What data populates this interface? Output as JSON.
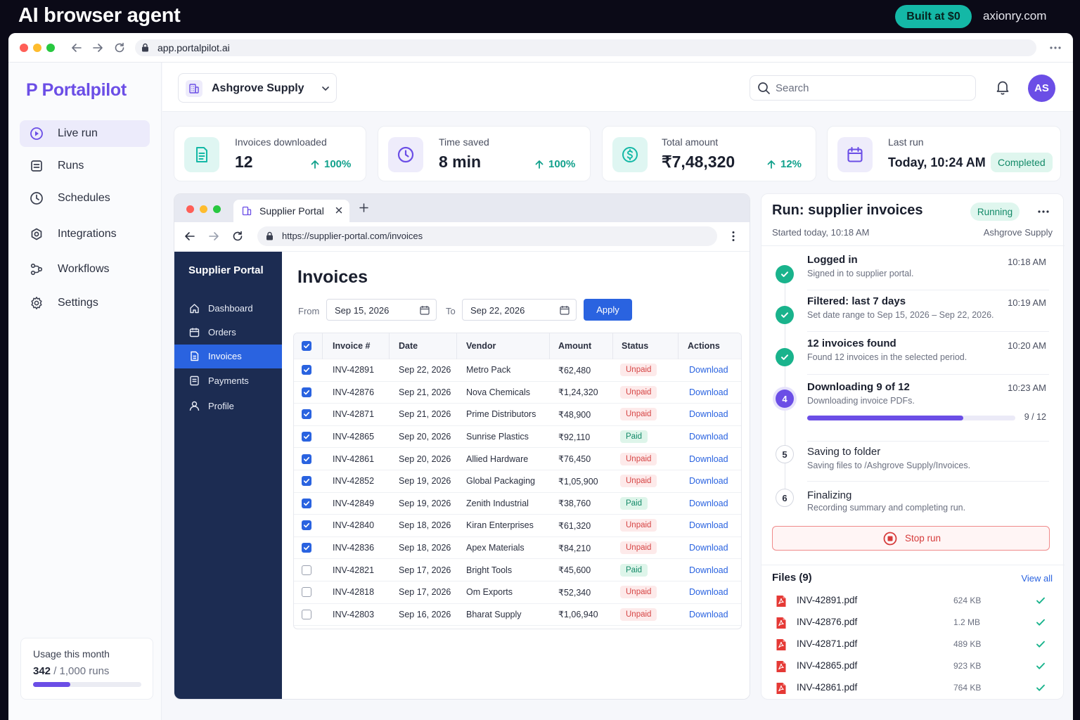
{
  "banner": {
    "title": "AI browser agent",
    "pill": "Built at $0",
    "site": "axionry.com"
  },
  "browser": {
    "url": "app.portalpilot.ai"
  },
  "app": {
    "logo": "P Portalpilot",
    "nav": [
      {
        "label": "Live run",
        "icon": "play-circle-icon",
        "active": true
      },
      {
        "label": "Runs",
        "icon": "list-icon"
      },
      {
        "label": "Schedules",
        "icon": "clock-icon"
      },
      {
        "label": "Integrations",
        "icon": "puzzle-icon"
      },
      {
        "label": "Workflows",
        "icon": "workflow-icon"
      },
      {
        "label": "Settings",
        "icon": "gear-icon"
      }
    ],
    "usage": {
      "title": "Usage this month",
      "used": "342",
      "total": "/ 1,000 runs",
      "fraction": 0.342
    }
  },
  "header": {
    "org": "Ashgrove Supply",
    "search_placeholder": "Search",
    "avatar": "AS"
  },
  "stats": [
    {
      "label": "Invoices downloaded",
      "value": "12",
      "trend": "100%",
      "color": "#14b8a6"
    },
    {
      "label": "Time saved",
      "value": "8 min",
      "trend": "100%",
      "color": "#6b4ee6"
    },
    {
      "label": "Total amount",
      "value": "₹7,48,320",
      "trend": "12%",
      "color": "#14b8a6"
    },
    {
      "label": "Last run",
      "value": "Today, 10:24 AM",
      "badge": "Completed",
      "color": "#6b4ee6"
    }
  ],
  "portal": {
    "tab_title": "Supplier Portal",
    "url": "https://supplier-portal.com/invoices",
    "brand": "Supplier Portal",
    "nav": [
      {
        "label": "Dashboard",
        "icon": "home-icon"
      },
      {
        "label": "Orders",
        "icon": "orders-icon"
      },
      {
        "label": "Invoices",
        "icon": "invoice-icon",
        "active": true
      },
      {
        "label": "Payments",
        "icon": "payments-icon"
      },
      {
        "label": "Profile",
        "icon": "user-icon"
      }
    ],
    "page_title": "Invoices",
    "filter": {
      "from_label": "From",
      "from": "Sep 15, 2026",
      "to_label": "To",
      "to": "Sep 22, 2026",
      "apply": "Apply"
    },
    "columns": [
      "Invoice #",
      "Date",
      "Vendor",
      "Amount",
      "Status",
      "Actions"
    ],
    "rows": [
      {
        "checked": true,
        "id": "INV-42891",
        "date": "Sep 22, 2026",
        "vendor": "Metro Pack",
        "amount": "₹62,480",
        "status": "Unpaid",
        "action": "Download"
      },
      {
        "checked": true,
        "id": "INV-42876",
        "date": "Sep 21, 2026",
        "vendor": "Nova Chemicals",
        "amount": "₹1,24,320",
        "status": "Unpaid",
        "action": "Download"
      },
      {
        "checked": true,
        "id": "INV-42871",
        "date": "Sep 21, 2026",
        "vendor": "Prime Distributors",
        "amount": "₹48,900",
        "status": "Unpaid",
        "action": "Download"
      },
      {
        "checked": true,
        "id": "INV-42865",
        "date": "Sep 20, 2026",
        "vendor": "Sunrise Plastics",
        "amount": "₹92,110",
        "status": "Paid",
        "action": "Download"
      },
      {
        "checked": true,
        "id": "INV-42861",
        "date": "Sep 20, 2026",
        "vendor": "Allied Hardware",
        "amount": "₹76,450",
        "status": "Unpaid",
        "action": "Download"
      },
      {
        "checked": true,
        "id": "INV-42852",
        "date": "Sep 19, 2026",
        "vendor": "Global Packaging",
        "amount": "₹1,05,900",
        "status": "Unpaid",
        "action": "Download"
      },
      {
        "checked": true,
        "id": "INV-42849",
        "date": "Sep 19, 2026",
        "vendor": "Zenith Industrial",
        "amount": "₹38,760",
        "status": "Paid",
        "action": "Download"
      },
      {
        "checked": true,
        "id": "INV-42840",
        "date": "Sep 18, 2026",
        "vendor": "Kiran Enterprises",
        "amount": "₹61,320",
        "status": "Unpaid",
        "action": "Download"
      },
      {
        "checked": true,
        "id": "INV-42836",
        "date": "Sep 18, 2026",
        "vendor": "Apex Materials",
        "amount": "₹84,210",
        "status": "Unpaid",
        "action": "Download"
      },
      {
        "checked": false,
        "id": "INV-42821",
        "date": "Sep 17, 2026",
        "vendor": "Bright Tools",
        "amount": "₹45,600",
        "status": "Paid",
        "action": "Download"
      },
      {
        "checked": false,
        "id": "INV-42818",
        "date": "Sep 17, 2026",
        "vendor": "Om Exports",
        "amount": "₹52,340",
        "status": "Unpaid",
        "action": "Download"
      },
      {
        "checked": false,
        "id": "INV-42803",
        "date": "Sep 16, 2026",
        "vendor": "Bharat Supply",
        "amount": "₹1,06,940",
        "status": "Unpaid",
        "action": "Download"
      }
    ]
  },
  "run": {
    "title": "Run: supplier invoices",
    "status": "Running",
    "started": "Started today, 10:18 AM",
    "org": "Ashgrove Supply",
    "steps": [
      {
        "state": "done",
        "title": "Logged in",
        "desc": "Signed in to supplier portal.",
        "time": "10:18 AM"
      },
      {
        "state": "done",
        "title": "Filtered: last 7 days",
        "desc": "Set date range to Sep 15, 2026 – Sep 22, 2026.",
        "time": "10:19 AM"
      },
      {
        "state": "done",
        "title": "12 invoices found",
        "desc": "Found 12 invoices in the selected period.",
        "time": "10:20 AM"
      },
      {
        "state": "active",
        "num": "4",
        "title": "Downloading 9 of 12",
        "desc": "Downloading invoice PDFs.",
        "time": "10:23 AM"
      },
      {
        "state": "pending",
        "num": "5",
        "title": "Saving to folder",
        "desc": "Saving files to /Ashgrove Supply/Invoices."
      },
      {
        "state": "pending",
        "num": "6",
        "title": "Finalizing",
        "desc": "Recording summary and completing run."
      }
    ],
    "progress": {
      "label": "9 / 12",
      "fraction": 0.75
    },
    "stop": "Stop run",
    "files_title": "Files (9)",
    "view_all": "View all",
    "files": [
      {
        "name": "INV-42891.pdf",
        "size": "624 KB"
      },
      {
        "name": "INV-42876.pdf",
        "size": "1.2 MB"
      },
      {
        "name": "INV-42871.pdf",
        "size": "489 KB"
      },
      {
        "name": "INV-42865.pdf",
        "size": "923 KB"
      },
      {
        "name": "INV-42861.pdf",
        "size": "764 KB"
      }
    ]
  }
}
